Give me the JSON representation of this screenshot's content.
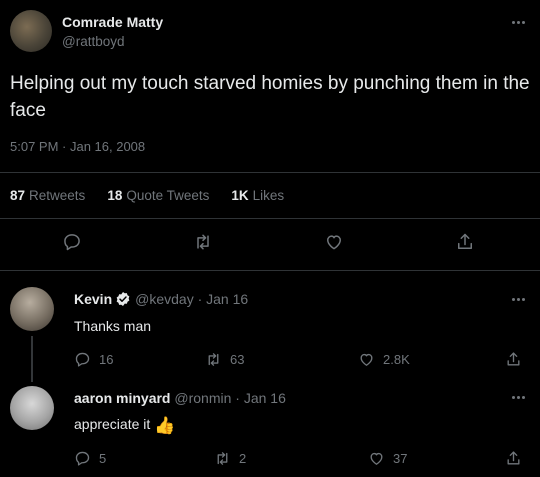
{
  "tweet": {
    "author_name": "Comrade Matty",
    "author_handle": "@rattboyd",
    "text": "Helping out my touch starved homies by punching them in the face",
    "timestamp": "5:07 PM · Jan 16, 2008",
    "stats": {
      "retweets_count": "87",
      "retweets_label": "Retweets",
      "quotes_count": "18",
      "quotes_label": "Quote Tweets",
      "likes_count": "1K",
      "likes_label": "Likes"
    },
    "actions": [
      "reply-icon",
      "retweet-icon",
      "like-icon",
      "share-icon"
    ]
  },
  "replies": [
    {
      "name": "Kevin",
      "verified": true,
      "handle": "@kevday",
      "date": "· Jan 16",
      "text": "Thanks man",
      "replies": "16",
      "retweets": "63",
      "likes": "2.8K"
    },
    {
      "name": "aaron minyard",
      "verified": false,
      "handle": "@ronmin",
      "date": "· Jan 16",
      "text": "appreciate it",
      "emoji": "👍",
      "replies": "5",
      "retweets": "2",
      "likes": "37"
    }
  ],
  "colors": {
    "background": "#000000",
    "text": "#e7e9ea",
    "muted": "#71767b",
    "divider": "#2f3336",
    "verified": "#1d9bf0"
  }
}
